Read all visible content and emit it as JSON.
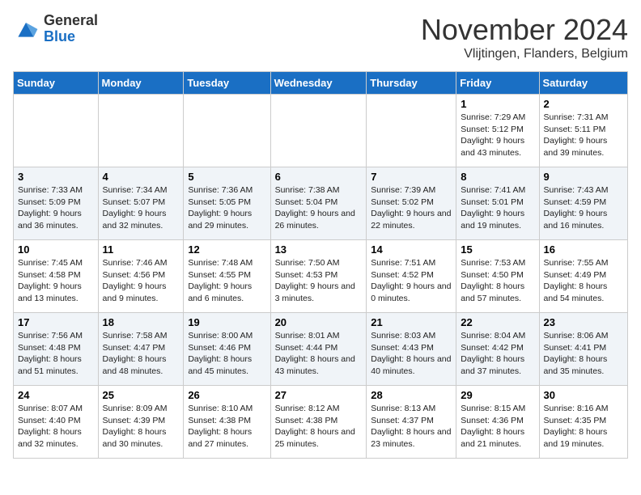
{
  "logo": {
    "general": "General",
    "blue": "Blue"
  },
  "header": {
    "month": "November 2024",
    "location": "Vlijtingen, Flanders, Belgium"
  },
  "weekdays": [
    "Sunday",
    "Monday",
    "Tuesday",
    "Wednesday",
    "Thursday",
    "Friday",
    "Saturday"
  ],
  "weeks": [
    [
      {
        "day": "",
        "sunrise": "",
        "sunset": "",
        "daylight": ""
      },
      {
        "day": "",
        "sunrise": "",
        "sunset": "",
        "daylight": ""
      },
      {
        "day": "",
        "sunrise": "",
        "sunset": "",
        "daylight": ""
      },
      {
        "day": "",
        "sunrise": "",
        "sunset": "",
        "daylight": ""
      },
      {
        "day": "",
        "sunrise": "",
        "sunset": "",
        "daylight": ""
      },
      {
        "day": "1",
        "sunrise": "Sunrise: 7:29 AM",
        "sunset": "Sunset: 5:12 PM",
        "daylight": "Daylight: 9 hours and 43 minutes."
      },
      {
        "day": "2",
        "sunrise": "Sunrise: 7:31 AM",
        "sunset": "Sunset: 5:11 PM",
        "daylight": "Daylight: 9 hours and 39 minutes."
      }
    ],
    [
      {
        "day": "3",
        "sunrise": "Sunrise: 7:33 AM",
        "sunset": "Sunset: 5:09 PM",
        "daylight": "Daylight: 9 hours and 36 minutes."
      },
      {
        "day": "4",
        "sunrise": "Sunrise: 7:34 AM",
        "sunset": "Sunset: 5:07 PM",
        "daylight": "Daylight: 9 hours and 32 minutes."
      },
      {
        "day": "5",
        "sunrise": "Sunrise: 7:36 AM",
        "sunset": "Sunset: 5:05 PM",
        "daylight": "Daylight: 9 hours and 29 minutes."
      },
      {
        "day": "6",
        "sunrise": "Sunrise: 7:38 AM",
        "sunset": "Sunset: 5:04 PM",
        "daylight": "Daylight: 9 hours and 26 minutes."
      },
      {
        "day": "7",
        "sunrise": "Sunrise: 7:39 AM",
        "sunset": "Sunset: 5:02 PM",
        "daylight": "Daylight: 9 hours and 22 minutes."
      },
      {
        "day": "8",
        "sunrise": "Sunrise: 7:41 AM",
        "sunset": "Sunset: 5:01 PM",
        "daylight": "Daylight: 9 hours and 19 minutes."
      },
      {
        "day": "9",
        "sunrise": "Sunrise: 7:43 AM",
        "sunset": "Sunset: 4:59 PM",
        "daylight": "Daylight: 9 hours and 16 minutes."
      }
    ],
    [
      {
        "day": "10",
        "sunrise": "Sunrise: 7:45 AM",
        "sunset": "Sunset: 4:58 PM",
        "daylight": "Daylight: 9 hours and 13 minutes."
      },
      {
        "day": "11",
        "sunrise": "Sunrise: 7:46 AM",
        "sunset": "Sunset: 4:56 PM",
        "daylight": "Daylight: 9 hours and 9 minutes."
      },
      {
        "day": "12",
        "sunrise": "Sunrise: 7:48 AM",
        "sunset": "Sunset: 4:55 PM",
        "daylight": "Daylight: 9 hours and 6 minutes."
      },
      {
        "day": "13",
        "sunrise": "Sunrise: 7:50 AM",
        "sunset": "Sunset: 4:53 PM",
        "daylight": "Daylight: 9 hours and 3 minutes."
      },
      {
        "day": "14",
        "sunrise": "Sunrise: 7:51 AM",
        "sunset": "Sunset: 4:52 PM",
        "daylight": "Daylight: 9 hours and 0 minutes."
      },
      {
        "day": "15",
        "sunrise": "Sunrise: 7:53 AM",
        "sunset": "Sunset: 4:50 PM",
        "daylight": "Daylight: 8 hours and 57 minutes."
      },
      {
        "day": "16",
        "sunrise": "Sunrise: 7:55 AM",
        "sunset": "Sunset: 4:49 PM",
        "daylight": "Daylight: 8 hours and 54 minutes."
      }
    ],
    [
      {
        "day": "17",
        "sunrise": "Sunrise: 7:56 AM",
        "sunset": "Sunset: 4:48 PM",
        "daylight": "Daylight: 8 hours and 51 minutes."
      },
      {
        "day": "18",
        "sunrise": "Sunrise: 7:58 AM",
        "sunset": "Sunset: 4:47 PM",
        "daylight": "Daylight: 8 hours and 48 minutes."
      },
      {
        "day": "19",
        "sunrise": "Sunrise: 8:00 AM",
        "sunset": "Sunset: 4:46 PM",
        "daylight": "Daylight: 8 hours and 45 minutes."
      },
      {
        "day": "20",
        "sunrise": "Sunrise: 8:01 AM",
        "sunset": "Sunset: 4:44 PM",
        "daylight": "Daylight: 8 hours and 43 minutes."
      },
      {
        "day": "21",
        "sunrise": "Sunrise: 8:03 AM",
        "sunset": "Sunset: 4:43 PM",
        "daylight": "Daylight: 8 hours and 40 minutes."
      },
      {
        "day": "22",
        "sunrise": "Sunrise: 8:04 AM",
        "sunset": "Sunset: 4:42 PM",
        "daylight": "Daylight: 8 hours and 37 minutes."
      },
      {
        "day": "23",
        "sunrise": "Sunrise: 8:06 AM",
        "sunset": "Sunset: 4:41 PM",
        "daylight": "Daylight: 8 hours and 35 minutes."
      }
    ],
    [
      {
        "day": "24",
        "sunrise": "Sunrise: 8:07 AM",
        "sunset": "Sunset: 4:40 PM",
        "daylight": "Daylight: 8 hours and 32 minutes."
      },
      {
        "day": "25",
        "sunrise": "Sunrise: 8:09 AM",
        "sunset": "Sunset: 4:39 PM",
        "daylight": "Daylight: 8 hours and 30 minutes."
      },
      {
        "day": "26",
        "sunrise": "Sunrise: 8:10 AM",
        "sunset": "Sunset: 4:38 PM",
        "daylight": "Daylight: 8 hours and 27 minutes."
      },
      {
        "day": "27",
        "sunrise": "Sunrise: 8:12 AM",
        "sunset": "Sunset: 4:38 PM",
        "daylight": "Daylight: 8 hours and 25 minutes."
      },
      {
        "day": "28",
        "sunrise": "Sunrise: 8:13 AM",
        "sunset": "Sunset: 4:37 PM",
        "daylight": "Daylight: 8 hours and 23 minutes."
      },
      {
        "day": "29",
        "sunrise": "Sunrise: 8:15 AM",
        "sunset": "Sunset: 4:36 PM",
        "daylight": "Daylight: 8 hours and 21 minutes."
      },
      {
        "day": "30",
        "sunrise": "Sunrise: 8:16 AM",
        "sunset": "Sunset: 4:35 PM",
        "daylight": "Daylight: 8 hours and 19 minutes."
      }
    ]
  ]
}
